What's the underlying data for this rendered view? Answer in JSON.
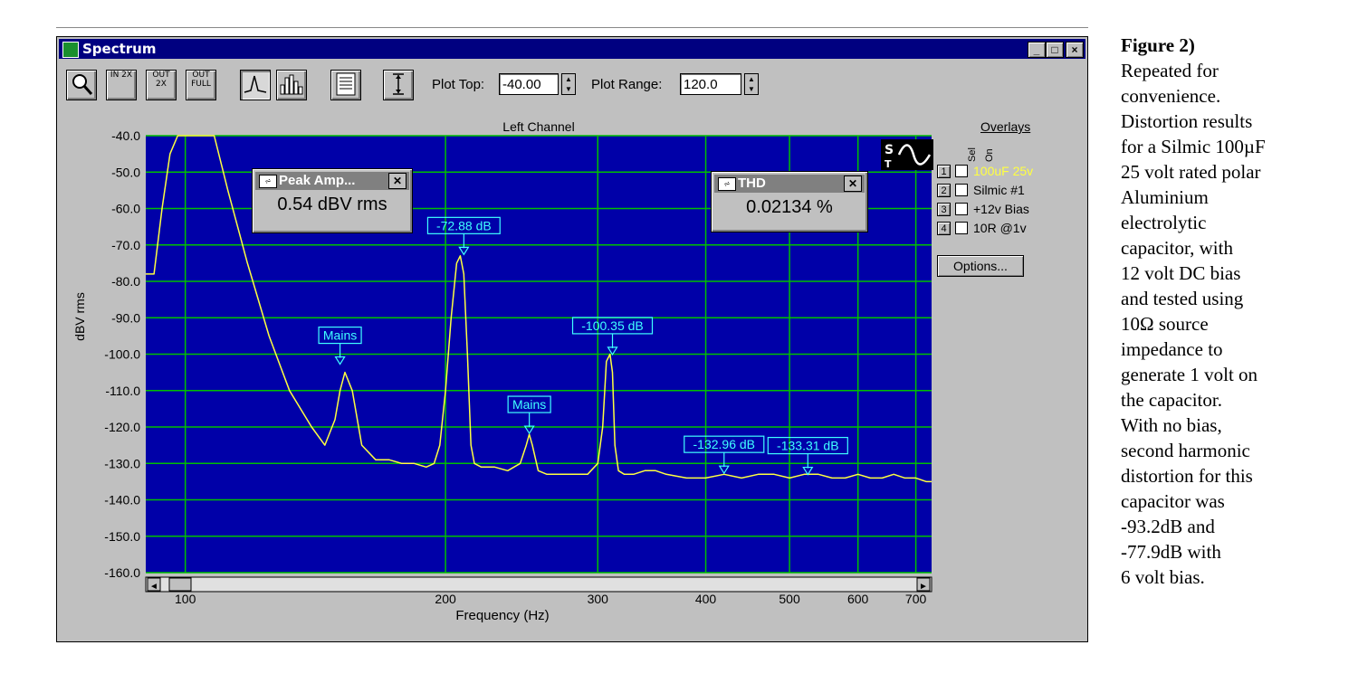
{
  "window": {
    "title": "Spectrum",
    "controls": {
      "minimize": "_",
      "maximize": "□",
      "close": "×"
    }
  },
  "toolbar": {
    "buttons": [
      {
        "name": "zoom-button",
        "icon": "magnifier-icon",
        "label": ""
      },
      {
        "name": "zoom-in-2x-button",
        "icon": "zoom-in-icon",
        "label": "IN 2X"
      },
      {
        "name": "zoom-out-2x-button",
        "icon": "zoom-out-icon",
        "label": "OUT 2X"
      },
      {
        "name": "zoom-out-full-button",
        "icon": "zoom-full-icon",
        "label": "OUT FULL"
      },
      {
        "name": "line-mode-button",
        "icon": "line-spectrum-icon",
        "label": ""
      },
      {
        "name": "bar-mode-button",
        "icon": "bar-spectrum-icon",
        "label": ""
      },
      {
        "name": "table-button",
        "icon": "table-icon",
        "label": ""
      },
      {
        "name": "autoscale-button",
        "icon": "vertical-range-icon",
        "label": ""
      }
    ],
    "plot_top_label": "Plot Top:",
    "plot_top_value": "-40.00",
    "plot_range_label": "Plot Range:",
    "plot_range_value": "120.0"
  },
  "plot": {
    "bg_color": "#0000a8",
    "grid_color": "#00c000",
    "trace_color": "#ffff40",
    "annot_color": "#40ffff",
    "channel_title": "Left Channel"
  },
  "overlays": {
    "title": "Overlays",
    "col_sel": "Sel",
    "col_on": "On",
    "items": [
      {
        "num": "1",
        "name": "100uF 25v",
        "color": "#ffff40"
      },
      {
        "num": "2",
        "name": "Silmic #1",
        "color": "#000000"
      },
      {
        "num": "3",
        "name": "+12v Bias",
        "color": "#000000"
      },
      {
        "num": "4",
        "name": "10R @1v",
        "color": "#000000"
      }
    ],
    "options_label": "Options..."
  },
  "peak_popup": {
    "title": "Peak Amp...",
    "value": "0.54 dBV rms"
  },
  "thd_popup": {
    "title": "THD",
    "value": "0.02134 %"
  },
  "chart_data": {
    "type": "line",
    "title": "Left Channel",
    "xlabel": "Frequency (Hz)",
    "ylabel": "dBV rms",
    "xscale": "log",
    "xlim": [
      90,
      730
    ],
    "ylim": [
      -160,
      -40
    ],
    "xticks": [
      100,
      200,
      300,
      400,
      500,
      600,
      700
    ],
    "yticks": [
      -40,
      -50,
      -60,
      -70,
      -80,
      -90,
      -100,
      -110,
      -120,
      -130,
      -140,
      -150,
      -160
    ],
    "ytick_labels": [
      "-40.0",
      "-50.0",
      "-60.0",
      "-70.0",
      "-80.0",
      "-90.0",
      "-100.0",
      "-110.0",
      "-120.0",
      "-130.0",
      "-140.0",
      "-150.0",
      "-160.0"
    ],
    "grid": true,
    "series": [
      {
        "x": [
          90,
          92,
          94,
          96,
          98,
          100,
          102,
          104,
          106,
          108,
          112,
          118,
          125,
          132,
          140,
          145,
          149,
          151,
          153,
          156,
          160,
          166,
          172,
          178,
          184,
          190,
          194,
          197,
          200,
          203,
          206,
          208,
          210,
          212,
          214,
          216,
          220,
          228,
          236,
          244,
          248,
          250,
          252,
          256,
          262,
          270,
          280,
          292,
          300,
          304,
          307,
          310,
          312,
          314,
          317,
          322,
          330,
          340,
          350,
          360,
          380,
          400,
          420,
          440,
          460,
          480,
          500,
          520,
          540,
          560,
          580,
          600,
          620,
          640,
          660,
          680,
          700,
          720,
          730
        ],
        "y": [
          -78,
          -78,
          -60,
          -45,
          -40,
          -40,
          -40,
          -40,
          -40,
          -40,
          -55,
          -75,
          -95,
          -110,
          -120,
          -125,
          -118,
          -110,
          -105,
          -110,
          -125,
          -129,
          -129,
          -130,
          -130,
          -131,
          -130,
          -125,
          -110,
          -90,
          -75,
          -73,
          -78,
          -100,
          -125,
          -130,
          -131,
          -131,
          -132,
          -130,
          -125,
          -122,
          -125,
          -132,
          -133,
          -133,
          -133,
          -133,
          -130,
          -120,
          -102,
          -100,
          -105,
          -125,
          -132,
          -133,
          -133,
          -132,
          -132,
          -133,
          -134,
          -134,
          -133,
          -134,
          -133,
          -133,
          -134,
          -133,
          -133,
          -134,
          -134,
          -133,
          -134,
          -134,
          -133,
          -134,
          -134,
          -135,
          -135
        ]
      }
    ],
    "annotations": [
      {
        "text": "-72.88 dB",
        "x": 210,
        "y": -72.88
      },
      {
        "text": "Mains",
        "x": 151,
        "y": -103
      },
      {
        "text": "-100.35 dB",
        "x": 312,
        "y": -100.35
      },
      {
        "text": "Mains",
        "x": 250,
        "y": -122
      },
      {
        "text": "-132.96 dB",
        "x": 420,
        "y": -132.96
      },
      {
        "text": "-133.31 dB",
        "x": 525,
        "y": -133.31
      }
    ],
    "scrollbar": {
      "left_arrow": "◄",
      "right_arrow": "►"
    }
  },
  "caption": {
    "heading": "Figure 2)",
    "lines": [
      "Repeated for",
      "convenience.",
      "Distortion results",
      "for a Silmic 100µF",
      "25 volt rated polar",
      "Aluminium",
      "electrolytic",
      "capacitor, with",
      "12 volt DC bias",
      "and tested using",
      "10Ω source",
      "impedance to",
      "generate 1 volt on",
      "the capacitor.",
      "With no bias,",
      "second harmonic",
      "distortion for this",
      "capacitor was",
      "-93.2dB and",
      "-77.9dB with",
      "6 volt bias."
    ]
  }
}
